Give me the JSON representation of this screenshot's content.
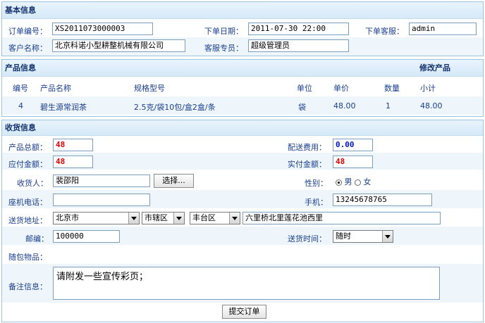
{
  "basic": {
    "header": "基本信息",
    "order_no_label": "订单编号：",
    "order_no_value": "XS2011073000003",
    "order_date_label": "下单日期：",
    "order_date_value": "2011-07-30 22:00",
    "cs_label": "下单客服：",
    "cs_value": "admin",
    "customer_label": "客户名称：",
    "customer_value": "北京科诺小型耕整机械有限公司",
    "staff_label": "客服专员：",
    "staff_value": "超级管理员"
  },
  "product": {
    "header": "产品信息",
    "edit_link": "修改产品",
    "columns": [
      "编号",
      "产品名称",
      "规格型号",
      "单位",
      "单价",
      "数量",
      "小计"
    ],
    "rows": [
      [
        "4",
        "碧生源常润茶",
        "2.5克/袋10包/盒2盒/条",
        "袋",
        "48.00",
        "1",
        "48.00"
      ]
    ]
  },
  "shipping": {
    "header": "收货信息",
    "total_label": "产品总额：",
    "total_value": "48",
    "delivery_fee_label": "配送费用：",
    "delivery_fee_value": "0.00",
    "payable_label": "应付金额：",
    "payable_value": "48",
    "paid_label": "实付金额：",
    "paid_value": "48",
    "receiver_label": "收货人：",
    "receiver_value": "裴邵阳",
    "choose_button": "选择...",
    "gender_label": "性别：",
    "gender_male": "男",
    "gender_female": "女",
    "phone_label": "座机电话：",
    "phone_value": "",
    "mobile_label": "手机：",
    "mobile_value": "13245678765",
    "address_label": "送货地址：",
    "province": "北京市",
    "city": "市辖区",
    "district": "丰台区",
    "street": "六里桥北里莲花池西里",
    "zip_label": "邮编：",
    "zip_value": "100000",
    "delivery_time_label": "送货时间：",
    "delivery_time_value": "随时",
    "items_label": "随包物品：",
    "remark_label": "备注信息：",
    "remark_value": "请附发一些宣传彩页；"
  },
  "submit_button": "提交订单"
}
